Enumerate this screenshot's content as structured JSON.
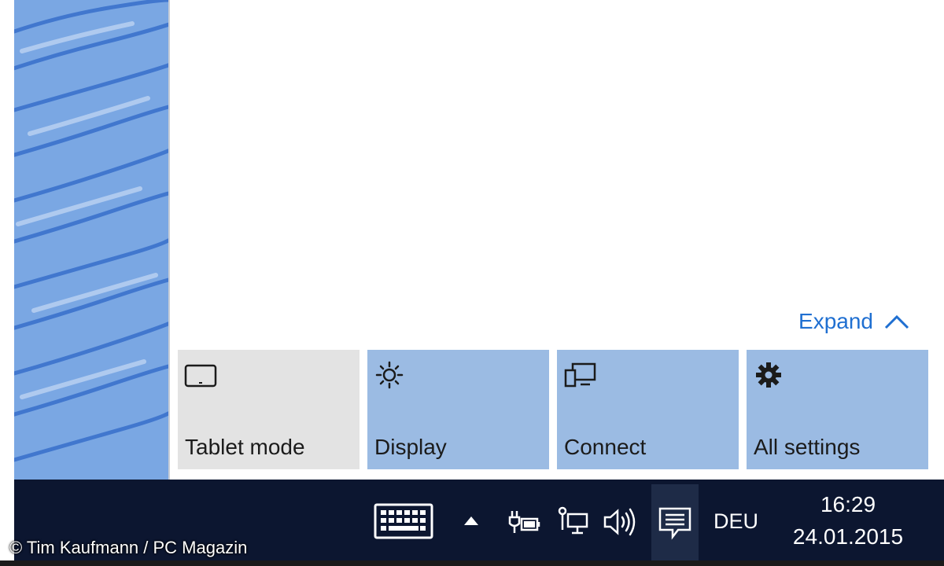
{
  "action_center": {
    "expand_label": "Expand",
    "tiles": [
      {
        "label": "Tablet mode",
        "icon": "tablet-icon",
        "state": "off"
      },
      {
        "label": "Display",
        "icon": "brightness-icon",
        "state": "on"
      },
      {
        "label": "Connect",
        "icon": "connect-icon",
        "state": "on"
      },
      {
        "label": "All settings",
        "icon": "gear-icon",
        "state": "on"
      }
    ]
  },
  "taskbar": {
    "language": "DEU",
    "time": "16:29",
    "date": "24.01.2015",
    "icons": [
      "keyboard-icon",
      "show-hidden-icons-icon",
      "battery-icon",
      "network-icon",
      "volume-icon",
      "action-center-icon"
    ]
  },
  "watermark": "© Tim Kaufmann / PC Magazin",
  "colors": {
    "accent": "#1f6fd1",
    "tile_on": "#9bbbe3",
    "tile_off": "#e3e3e3",
    "taskbar": "#0c1630"
  }
}
